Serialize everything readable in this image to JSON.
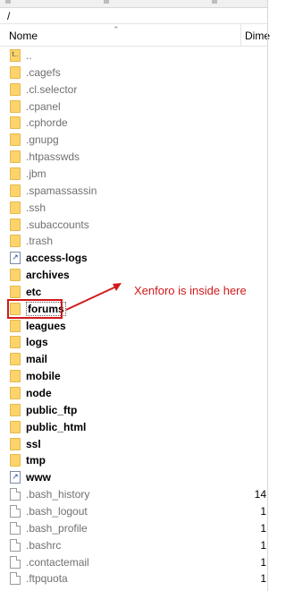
{
  "path": "/",
  "columns": {
    "name": "Nome",
    "dimension": "Dime"
  },
  "items": [
    {
      "name": "..",
      "icon": "parent-folder-icon",
      "size": ""
    },
    {
      "name": ".cagefs",
      "icon": "folder-icon",
      "size": ""
    },
    {
      "name": ".cl.selector",
      "icon": "folder-icon",
      "size": ""
    },
    {
      "name": ".cpanel",
      "icon": "folder-icon",
      "size": ""
    },
    {
      "name": ".cphorde",
      "icon": "folder-icon",
      "size": ""
    },
    {
      "name": ".gnupg",
      "icon": "folder-icon",
      "size": ""
    },
    {
      "name": ".htpasswds",
      "icon": "folder-icon",
      "size": ""
    },
    {
      "name": ".jbm",
      "icon": "folder-icon",
      "size": ""
    },
    {
      "name": ".spamassassin",
      "icon": "folder-icon",
      "size": ""
    },
    {
      "name": ".ssh",
      "icon": "folder-icon",
      "size": ""
    },
    {
      "name": ".subaccounts",
      "icon": "folder-icon",
      "size": ""
    },
    {
      "name": ".trash",
      "icon": "folder-icon",
      "size": ""
    },
    {
      "name": "access-logs",
      "icon": "folder-link-icon",
      "size": ""
    },
    {
      "name": "archives",
      "icon": "folder-icon",
      "size": ""
    },
    {
      "name": "etc",
      "icon": "folder-icon",
      "size": ""
    },
    {
      "name": "forums",
      "icon": "folder-icon",
      "size": ""
    },
    {
      "name": "leagues",
      "icon": "folder-icon",
      "size": ""
    },
    {
      "name": "logs",
      "icon": "folder-icon",
      "size": ""
    },
    {
      "name": "mail",
      "icon": "folder-icon",
      "size": ""
    },
    {
      "name": "mobile",
      "icon": "folder-icon",
      "size": ""
    },
    {
      "name": "node",
      "icon": "folder-icon",
      "size": ""
    },
    {
      "name": "public_ftp",
      "icon": "folder-icon",
      "size": ""
    },
    {
      "name": "public_html",
      "icon": "folder-icon",
      "size": ""
    },
    {
      "name": "ssl",
      "icon": "folder-icon",
      "size": ""
    },
    {
      "name": "tmp",
      "icon": "folder-icon",
      "size": ""
    },
    {
      "name": "www",
      "icon": "folder-link-icon",
      "size": ""
    },
    {
      "name": ".bash_history",
      "icon": "file-icon",
      "size": "14"
    },
    {
      "name": ".bash_logout",
      "icon": "file-icon",
      "size": "1"
    },
    {
      "name": ".bash_profile",
      "icon": "file-icon",
      "size": "1"
    },
    {
      "name": ".bashrc",
      "icon": "file-icon",
      "size": "1"
    },
    {
      "name": ".contactemail",
      "icon": "file-icon",
      "size": "1"
    },
    {
      "name": ".ftpquota",
      "icon": "file-icon",
      "size": "1"
    }
  ],
  "annotation": {
    "text": "Xenforo is inside here",
    "color": "#d11a1a"
  },
  "colors": {
    "folder": "#fcd46b",
    "annotation": "#d11a1a"
  }
}
